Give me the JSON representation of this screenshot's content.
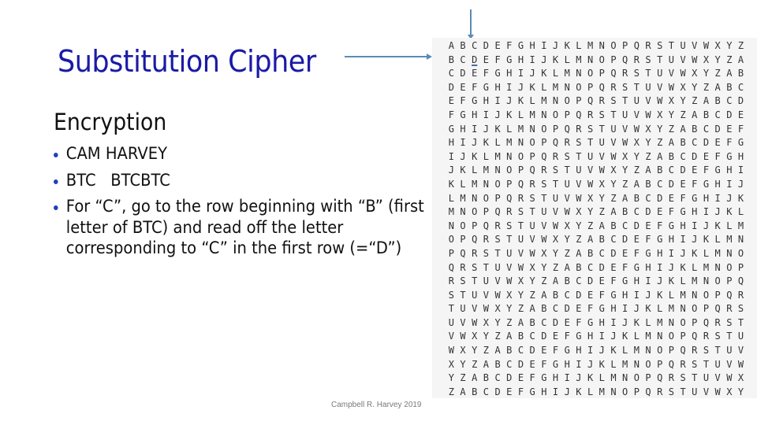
{
  "slide": {
    "title": "Substitution Cipher",
    "subtitle": "Encryption",
    "bullets": [
      "CAM HARVEY",
      "BTC   BTCBTC",
      "For “C”, go to the row beginning with “B” (first letter of BTC) and read off the letter corresponding to “C” in the first row (=“D”)"
    ],
    "footer": "Campbell R. Harvey 2019"
  },
  "table": {
    "alphabet": "ABCDEFGHIJKLMNOPQRSTUVWXYZ",
    "highlight": {
      "row": 1,
      "col": 2,
      "letter": "D"
    },
    "pointer_column_letter": "C",
    "pointer_row_letter": "B"
  },
  "colors": {
    "title": "#1a1aa6",
    "bullet": "#1f3fbf",
    "arrow": "#5b8ab8",
    "table_background": "#f5f5f5"
  }
}
